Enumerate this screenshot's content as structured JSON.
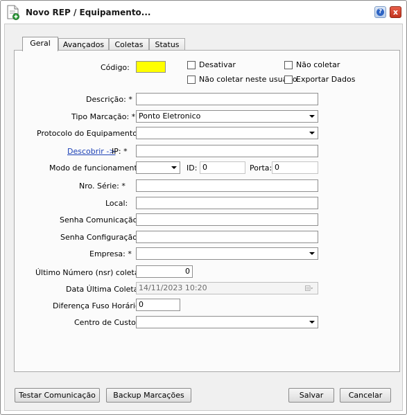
{
  "window": {
    "title": "Novo REP / Equipamento...",
    "help_label": "?",
    "close_label": "x"
  },
  "tabs": [
    {
      "label": "Geral",
      "active": true
    },
    {
      "label": "Avançados",
      "active": false
    },
    {
      "label": "Coletas",
      "active": false
    },
    {
      "label": "Status",
      "active": false
    }
  ],
  "form": {
    "codigo_label": "Código:",
    "codigo_value": "",
    "codigo_color": "#ffff00",
    "desativar_label": "Desativar",
    "nao_coletar_label": "Não coletar",
    "nao_coletar_usuario_label": "Não coletar neste usuário",
    "exportar_dados_label": "Exportar Dados",
    "descricao_label": "Descrição: *",
    "descricao_value": "",
    "tipo_marcacao_label": "Tipo Marcação: *",
    "tipo_marcacao_value": "Ponto Eletronico",
    "protocolo_label": "Protocolo do Equipamento: *",
    "protocolo_value": "",
    "descobrir_link": "Descobrir ->",
    "ip_label": "IP: *",
    "ip_value": "",
    "modo_label": "Modo de funcionamento:",
    "modo_value": "",
    "id_label": "ID:",
    "id_value": "0",
    "porta_label": "Porta:",
    "porta_value": "0",
    "nro_serie_label": "Nro. Série: *",
    "nro_serie_value": "",
    "local_label": "Local:",
    "local_value": "",
    "senha_comunicacao_label": "Senha Comunicação:",
    "senha_comunicacao_value": "",
    "senha_configuracao_label": "Senha Configuração:",
    "senha_configuracao_value": "",
    "empresa_label": "Empresa: *",
    "empresa_value": "",
    "ultimo_nsr_label": "Último Número (nsr) coletado:",
    "ultimo_nsr_value": "0",
    "data_ultima_coleta_label": "Data Última Coleta:",
    "data_ultima_coleta_value": "14/11/2023 10:20",
    "fuso_label": "Diferença Fuso Horário:",
    "fuso_value": "0",
    "centro_custo_label": "Centro de Custo:",
    "centro_custo_value": ""
  },
  "buttons": {
    "testar": "Testar Comunicação",
    "backup": "Backup Marcações",
    "salvar": "Salvar",
    "cancelar": "Cancelar"
  }
}
